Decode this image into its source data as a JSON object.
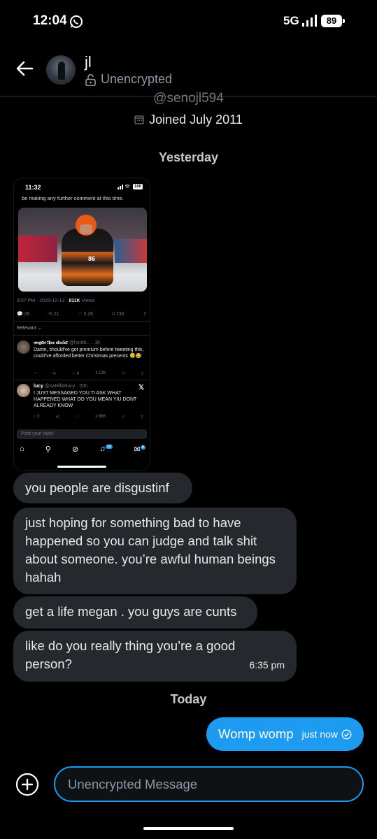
{
  "status_bar": {
    "time": "12:04",
    "network": "5G",
    "battery": "89"
  },
  "header": {
    "contact_name": "jl",
    "encryption_status": "Unencrypted"
  },
  "profile": {
    "handle": "@senojl594",
    "joined": "Joined July 2011"
  },
  "day_labels": {
    "yesterday": "Yesterday",
    "today": "Today"
  },
  "shared_screenshot": {
    "status_time": "11:32",
    "battery": "100",
    "top_text": "be making any further comment at this time.",
    "meta_time": "3:07 PM · 2025-12-13 ·",
    "meta_views": "811K",
    "meta_views_label": "Views",
    "stats": {
      "replies": "26",
      "reposts": "21",
      "likes": "3.2K",
      "bookmarks": "735"
    },
    "relevant": "Relevant ⌄",
    "replies": [
      {
        "name": "𝔪𝔢𝔤𝔞𝔫 𝔱𝔥𝔢𝔢 𝔰𝔱𝔢𝔢𝔩𝔢𝔯",
        "handle": "@hxrdti... · 1h",
        "text": "Damn, should've got premium before tweeting this, could've afforded better Christmas presents 🫠😂",
        "views": "13K"
      },
      {
        "name": "lucy",
        "handle": "@satellitelucy · 20h",
        "text": "I JUST MESSAGED YOU TI ASK WHAT HAPPENED WHAT DO YOU MEAN YIU DONT ALREADY KNOW",
        "replies": "3",
        "views": "68K"
      }
    ],
    "input_placeholder": "Post your reply",
    "notif_badge": "10",
    "msg_badge": "6"
  },
  "messages": {
    "incoming": [
      {
        "text": "you people are disgustinf"
      },
      {
        "text": "just hoping for something bad to have happened so you can judge and talk shit about someone. you’re awful human beings hahah"
      },
      {
        "text": "get a life megan . you guys are cunts"
      },
      {
        "text": "like do you really thing you’re a good person?",
        "time": "6:35 pm"
      }
    ],
    "outgoing": [
      {
        "text": "Womp womp",
        "time": "just now"
      }
    ]
  },
  "composer": {
    "placeholder": "Unencrypted Message"
  },
  "colors": {
    "accent": "#1d9bf0",
    "incoming_bubble": "#25292e",
    "background": "#000000"
  }
}
